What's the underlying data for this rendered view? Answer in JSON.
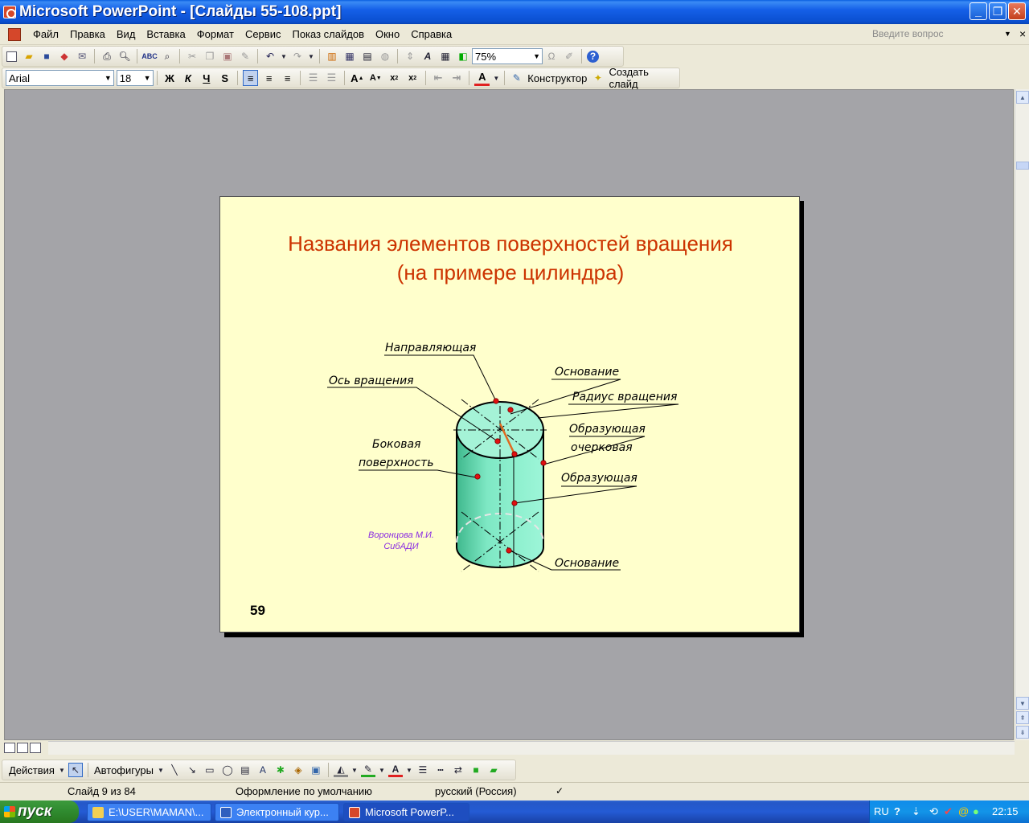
{
  "window": {
    "title": "Microsoft PowerPoint - [Слайды 55-108.ppt]"
  },
  "menu": {
    "items": [
      "Файл",
      "Правка",
      "Вид",
      "Вставка",
      "Формат",
      "Сервис",
      "Показ слайдов",
      "Окно",
      "Справка"
    ],
    "ask_placeholder": "Введите вопрос"
  },
  "toolbar": {
    "zoom": "75%",
    "font": "Arial",
    "font_size": "18",
    "designer_label": "Конструктор",
    "new_slide_label": "Создать слайд"
  },
  "slide": {
    "title_line1": "Названия элементов поверхностей вращения",
    "title_line2": "(на примере цилиндра)",
    "number": "59",
    "author_line1": "Воронцова М.И.",
    "author_line2": "СибАДИ",
    "labels": {
      "guide": "Направляющая",
      "axis": "Ось  вращения",
      "base_top": "Основание",
      "radius": "Радиус  вращения",
      "generatrix_outline_1": "Образующая",
      "generatrix_outline_2": "очерковая",
      "lateral_1": "Боковая",
      "lateral_2": "поверхность",
      "generatrix": "Образующая",
      "base_bottom": "Основание"
    }
  },
  "drawing_toolbar": {
    "actions_label": "Действия",
    "autoshapes_label": "Автофигуры"
  },
  "status": {
    "slide_counter": "Слайд 9 из 84",
    "design": "Оформление по умолчанию",
    "language": "русский (Россия)"
  },
  "taskbar": {
    "start_label": "пуск",
    "tasks": [
      "E:\\USER\\MAMAN\\...",
      "Электронный кур...",
      "Microsoft PowerP..."
    ],
    "lang": "RU",
    "clock": "22:15"
  },
  "colors": {
    "slide_bg": "#ffffcc",
    "title_color": "#cc3300",
    "author_color": "#8a2be2",
    "cylinder": "#6ee0b8"
  }
}
